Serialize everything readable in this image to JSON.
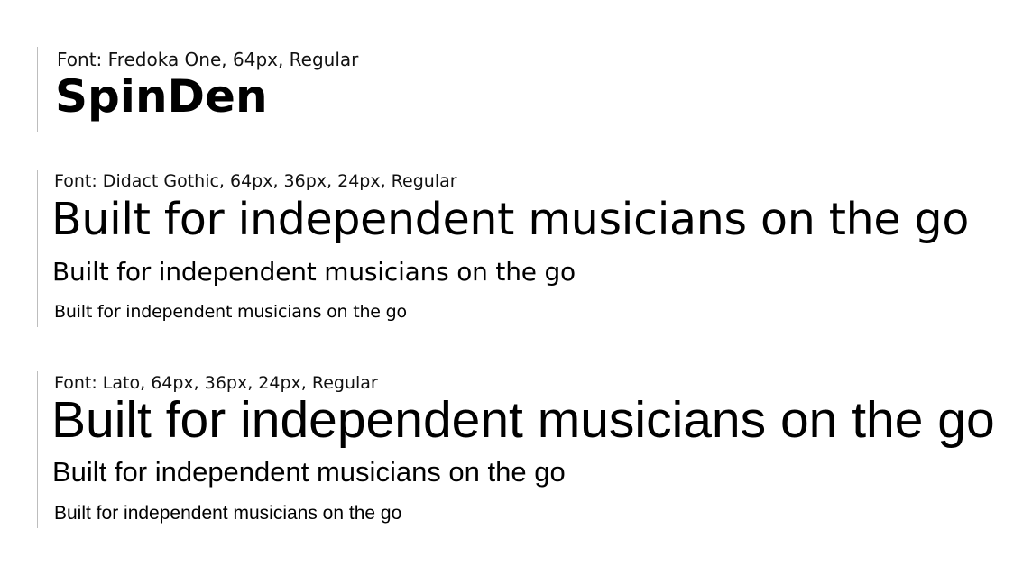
{
  "brand": {
    "label": "Font: Fredoka One, 64px, Regular",
    "name": "SpinDen"
  },
  "didact": {
    "label": "Font: Didact Gothic, 64px, 36px, 24px, Regular",
    "sample_64": "Built for independent musicians on the go",
    "sample_36": "Built for independent musicians on the go",
    "sample_24": "Built for independent musicians on the go"
  },
  "lato": {
    "label": "Font: Lato, 64px, 36px, 24px, Regular",
    "sample_64": "Built for independent musicians on the go",
    "sample_36": "Built for independent musicians on the go",
    "sample_24": "Built for independent musicians on the go"
  },
  "colors": {
    "text": "#000000",
    "divider": "#bdbdbd",
    "background": "#ffffff"
  }
}
